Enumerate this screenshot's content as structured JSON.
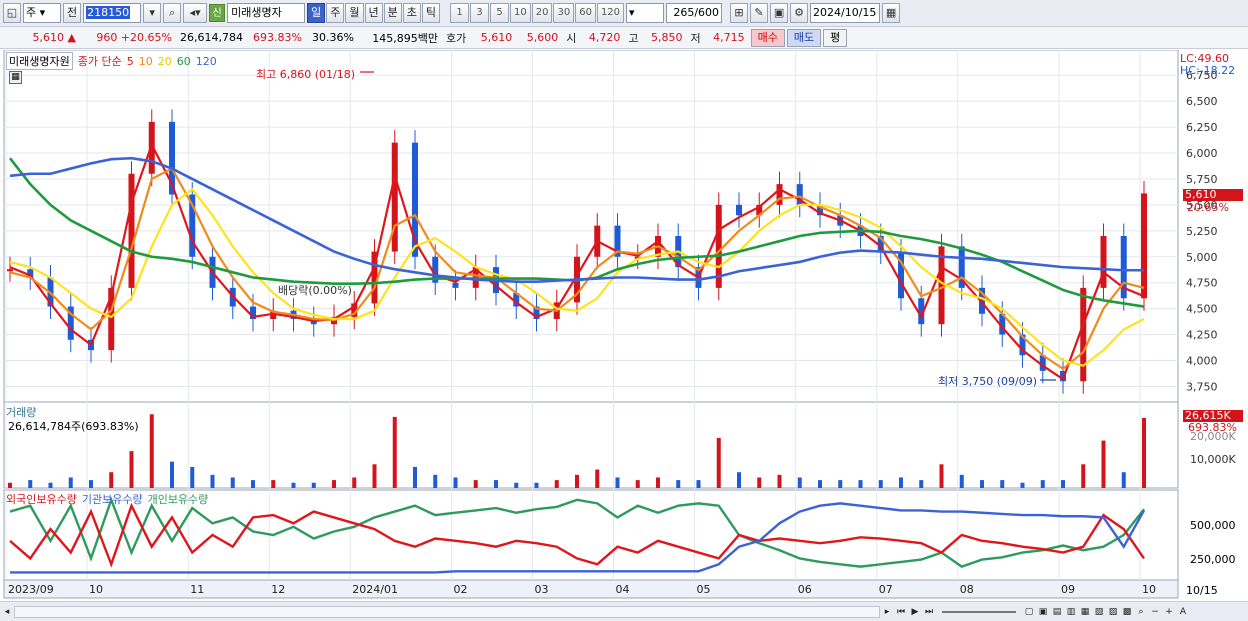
{
  "toolbar": {
    "market": "주",
    "prev_label": "전",
    "code": "218150",
    "sin_badge": "신",
    "stock_name": "미래생명자",
    "periods": [
      "일",
      "주",
      "월",
      "년",
      "분",
      "초",
      "틱"
    ],
    "active_period": "일",
    "intervals": [
      "1",
      "3",
      "5",
      "10",
      "20",
      "30",
      "60",
      "120"
    ],
    "count": "265",
    "count_max": "/600",
    "date": "2024/10/15"
  },
  "quote": {
    "price": "5,610 ▲",
    "change": "960 +20.65%",
    "volume": "26,614,784",
    "vol_ratio": "693.83%",
    "turnover": "30.36%",
    "amount": "145,895백만",
    "ask_label": "호가",
    "ask1": "5,610",
    "ask2": "5,600",
    "open_label": "시",
    "open": "4,720",
    "high_label": "고",
    "high": "5,850",
    "low_label": "저",
    "low": "4,715",
    "buy_btn": "매수",
    "sell_btn": "매도",
    "other_btn": "평"
  },
  "price_panel": {
    "stock_label": "미래생명자원",
    "ma_label": "종가 단순",
    "ma_periods": [
      "5",
      "10",
      "20",
      "60",
      "120"
    ],
    "lc": "LC:49.60",
    "hc": "HC:-18.22",
    "max_ann": "최고 6,860 (01/18)",
    "min_ann": "최저 3,750 (09/09)",
    "div_ann": "배당락(0.00%)",
    "current_price_tag": "5,610",
    "current_pct_tag": "20.65%",
    "y_ticks": [
      "6,750",
      "6,500",
      "6,250",
      "6,000",
      "5,750",
      "5,500",
      "5,250",
      "5,000",
      "4,750",
      "4,500",
      "4,250",
      "4,000",
      "3,750"
    ]
  },
  "volume_panel": {
    "title": "거래량",
    "value": "26,614,784주(693.83%)",
    "tag_value": "26,615K",
    "tag_pct": "693.83%",
    "hidden_tick": "20,000K",
    "tick": "10,000K"
  },
  "holding_panel": {
    "legend": [
      "외국인보유수량",
      "기관보유수량",
      "개인보유수량"
    ],
    "ticks": [
      "500,000",
      "250,000"
    ]
  },
  "x_axis": {
    "labels": [
      "2023/09",
      "10",
      "11",
      "12",
      "2024/01",
      "02",
      "03",
      "04",
      "05",
      "06",
      "07",
      "08",
      "09",
      "10"
    ],
    "right_label": "10/15"
  },
  "colors": {
    "up": "#d3141b",
    "down": "#1f5bd6",
    "ma5": "#e0161b",
    "ma10": "#f08a1a",
    "ma20": "#ffe31a",
    "ma60": "#1f9a3c",
    "ma120": "#3c63d6",
    "foreign": "#e0161b",
    "institution": "#3c63d6",
    "individual": "#2e9a5e"
  },
  "chart_data": {
    "type": "candlestick",
    "series": [
      {
        "name": "5",
        "values": [
          4900,
          4820,
          4550,
          4300,
          4150,
          4620,
          5520,
          6080,
          5700,
          5150,
          4850,
          4620,
          4420,
          4450,
          4420,
          4380,
          4400,
          4520,
          4900,
          5780,
          5150,
          4820,
          4760,
          4880,
          4720,
          4560,
          4420,
          4500,
          4820,
          5150,
          5050,
          5010,
          5150,
          4920,
          4800,
          5260,
          5380,
          5480,
          5650,
          5550,
          5420,
          5350,
          5250,
          5100,
          4750,
          4420,
          4900,
          4780,
          4560,
          4320,
          4100,
          3950,
          3820,
          4350,
          4850,
          4700,
          4620
        ]
      },
      {
        "name": "10",
        "values": [
          4850,
          4800,
          4650,
          4450,
          4300,
          4480,
          5080,
          5750,
          5850,
          5500,
          5100,
          4800,
          4560,
          4470,
          4440,
          4400,
          4390,
          4450,
          4700,
          5300,
          5400,
          5050,
          4850,
          4820,
          4800,
          4650,
          4500,
          4480,
          4640,
          4900,
          5050,
          5030,
          5100,
          5000,
          4870,
          5050,
          5250,
          5400,
          5560,
          5580,
          5480,
          5400,
          5300,
          5180,
          4950,
          4620,
          4700,
          4800,
          4650,
          4450,
          4230,
          4050,
          3920,
          4080,
          4500,
          4750,
          4700
        ]
      },
      {
        "name": "20",
        "values": [
          4950,
          4900,
          4800,
          4650,
          4500,
          4420,
          4600,
          5100,
          5500,
          5650,
          5400,
          5100,
          4850,
          4650,
          4500,
          4440,
          4400,
          4400,
          4480,
          4800,
          5100,
          5180,
          5050,
          4900,
          4830,
          4780,
          4650,
          4500,
          4480,
          4600,
          4850,
          4980,
          5020,
          5050,
          4950,
          4900,
          5050,
          5250,
          5400,
          5500,
          5500,
          5450,
          5380,
          5280,
          5100,
          4900,
          4750,
          4650,
          4600,
          4500,
          4320,
          4150,
          4000,
          3950,
          4100,
          4300,
          4400
        ]
      },
      {
        "name": "60",
        "values": [
          5950,
          5700,
          5500,
          5350,
          5250,
          5150,
          5050,
          5000,
          4980,
          4950,
          4900,
          4850,
          4800,
          4780,
          4760,
          4750,
          4740,
          4740,
          4745,
          4760,
          4780,
          4790,
          4790,
          4790,
          4790,
          4790,
          4790,
          4780,
          4770,
          4800,
          4880,
          4930,
          4970,
          4990,
          5000,
          5010,
          5050,
          5100,
          5150,
          5200,
          5230,
          5240,
          5250,
          5240,
          5200,
          5170,
          5130,
          5080,
          5020,
          4950,
          4860,
          4770,
          4680,
          4620,
          4580,
          4550,
          4520
        ]
      },
      {
        "name": "120",
        "values": [
          5780,
          5800,
          5800,
          5850,
          5900,
          5940,
          5950,
          5920,
          5850,
          5750,
          5650,
          5550,
          5450,
          5350,
          5250,
          5150,
          5050,
          4980,
          4920,
          4880,
          4850,
          4820,
          4800,
          4780,
          4770,
          4760,
          4760,
          4770,
          4780,
          4790,
          4800,
          4800,
          4790,
          4780,
          4780,
          4810,
          4860,
          4890,
          4920,
          4950,
          5000,
          5040,
          5060,
          5050,
          5040,
          5020,
          5000,
          4990,
          4980,
          4960,
          4940,
          4920,
          4900,
          4890,
          4880,
          4870,
          4870
        ]
      }
    ],
    "candles_close": [
      4880,
      4800,
      4520,
      4200,
      4100,
      4700,
      5800,
      6300,
      5600,
      5000,
      4700,
      4520,
      4400,
      4480,
      4400,
      4350,
      4420,
      4550,
      5050,
      6100,
      5000,
      4750,
      4700,
      4900,
      4650,
      4520,
      4400,
      4560,
      5000,
      5300,
      5000,
      5000,
      5200,
      4900,
      4700,
      5500,
      5400,
      5500,
      5700,
      5500,
      5400,
      5300,
      5200,
      5050,
      4600,
      4350,
      5100,
      4700,
      4450,
      4250,
      4050,
      3900,
      3800,
      4700,
      5200,
      4600,
      5610
    ],
    "y_range": [
      3600,
      6800
    ],
    "volume_bars": [
      2,
      3,
      2,
      4,
      3,
      6,
      14,
      28,
      10,
      8,
      5,
      4,
      3,
      3,
      2,
      2,
      3,
      4,
      9,
      27,
      8,
      5,
      4,
      3,
      3,
      2,
      2,
      3,
      5,
      7,
      4,
      3,
      4,
      3,
      3,
      19,
      6,
      4,
      5,
      4,
      3,
      3,
      3,
      3,
      4,
      3,
      9,
      5,
      3,
      3,
      2,
      3,
      3,
      9,
      18,
      6,
      26.6
    ],
    "volume_max_k": 30000,
    "holding_range": [
      0,
      700000
    ],
    "foreign": [
      300000,
      150000,
      400000,
      200000,
      550000,
      100000,
      600000,
      250000,
      500000,
      200000,
      350000,
      250000,
      500000,
      520000,
      450000,
      550000,
      500000,
      450000,
      400000,
      300000,
      250000,
      320000,
      300000,
      280000,
      250000,
      300000,
      280000,
      250000,
      150000,
      100000,
      250000,
      200000,
      300000,
      250000,
      200000,
      150000,
      350000,
      300000,
      320000,
      300000,
      280000,
      300000,
      330000,
      320000,
      300000,
      280000,
      200000,
      350000,
      300000,
      280000,
      250000,
      230000,
      200000,
      250000,
      520000,
      400000,
      150000
    ],
    "institution": [
      30000,
      30000,
      30000,
      30000,
      30000,
      30000,
      30000,
      30000,
      30000,
      30000,
      30000,
      30000,
      30000,
      30000,
      30000,
      30000,
      30000,
      30000,
      30000,
      30000,
      30000,
      30000,
      40000,
      40000,
      40000,
      40000,
      40000,
      40000,
      40000,
      40000,
      40000,
      40000,
      40000,
      40000,
      40000,
      100000,
      250000,
      300000,
      450000,
      550000,
      600000,
      620000,
      600000,
      580000,
      560000,
      560000,
      550000,
      550000,
      540000,
      530000,
      520000,
      520000,
      510000,
      510000,
      500000,
      250000,
      560000
    ],
    "individual": [
      550000,
      600000,
      300000,
      600000,
      150000,
      650000,
      200000,
      600000,
      300000,
      580000,
      450000,
      500000,
      380000,
      350000,
      420000,
      320000,
      380000,
      420000,
      500000,
      550000,
      600000,
      520000,
      540000,
      560000,
      580000,
      540000,
      570000,
      590000,
      650000,
      620000,
      500000,
      600000,
      540000,
      600000,
      620000,
      600000,
      350000,
      280000,
      220000,
      150000,
      120000,
      100000,
      80000,
      100000,
      120000,
      140000,
      200000,
      80000,
      140000,
      160000,
      200000,
      220000,
      260000,
      220000,
      250000,
      350000,
      570000
    ]
  }
}
